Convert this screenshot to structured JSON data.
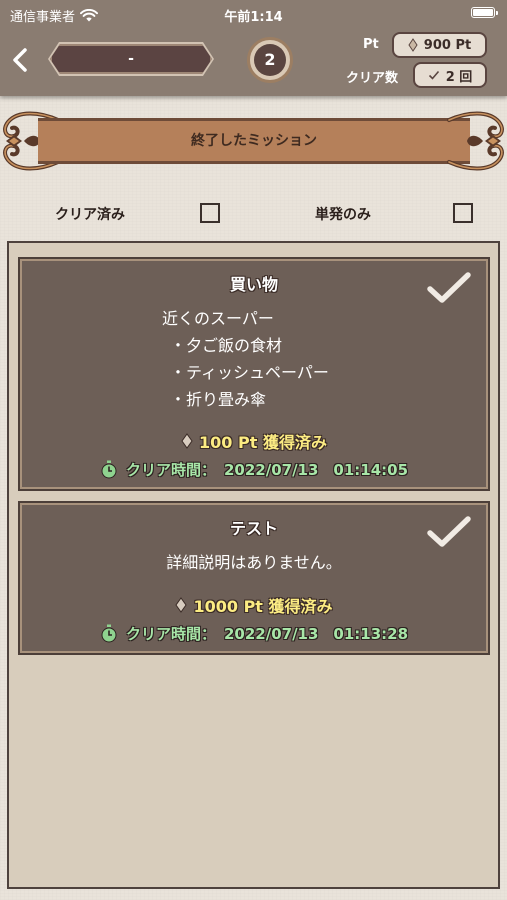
{
  "status_bar": {
    "carrier": "通信事業者",
    "time": "午前1:14"
  },
  "header": {
    "name_value": "-",
    "level": "2",
    "pt_label": "Pt",
    "pt_value": "900 Pt",
    "clear_count_label": "クリア数",
    "clear_count_value": "2 回"
  },
  "banner": {
    "title": "終了したミッション"
  },
  "filters": {
    "cleared_label": "クリア済み",
    "single_label": "単発のみ"
  },
  "missions": [
    {
      "title": "買い物",
      "description_lines": [
        "近くのスーパー",
        "・夕ご飯の食材",
        "・ティッシュペーパー",
        "・折り畳み傘"
      ],
      "points": "100 Pt 獲得済み",
      "clear_time_label": "クリア時間：",
      "clear_time_value": "2022/07/13　01:14:05"
    },
    {
      "title": "テスト",
      "description_lines": [
        "詳細説明はありません。"
      ],
      "points": "1000 Pt 獲得済み",
      "clear_time_label": "クリア時間：",
      "clear_time_value": "2022/07/13　01:13:28"
    }
  ],
  "colors": {
    "header_bg": "#8a7c71",
    "card_bg": "#6d5f57",
    "points_text": "#fcec83",
    "clear_time_text": "#a8e6a8",
    "banner_bg": "#b5805a"
  }
}
